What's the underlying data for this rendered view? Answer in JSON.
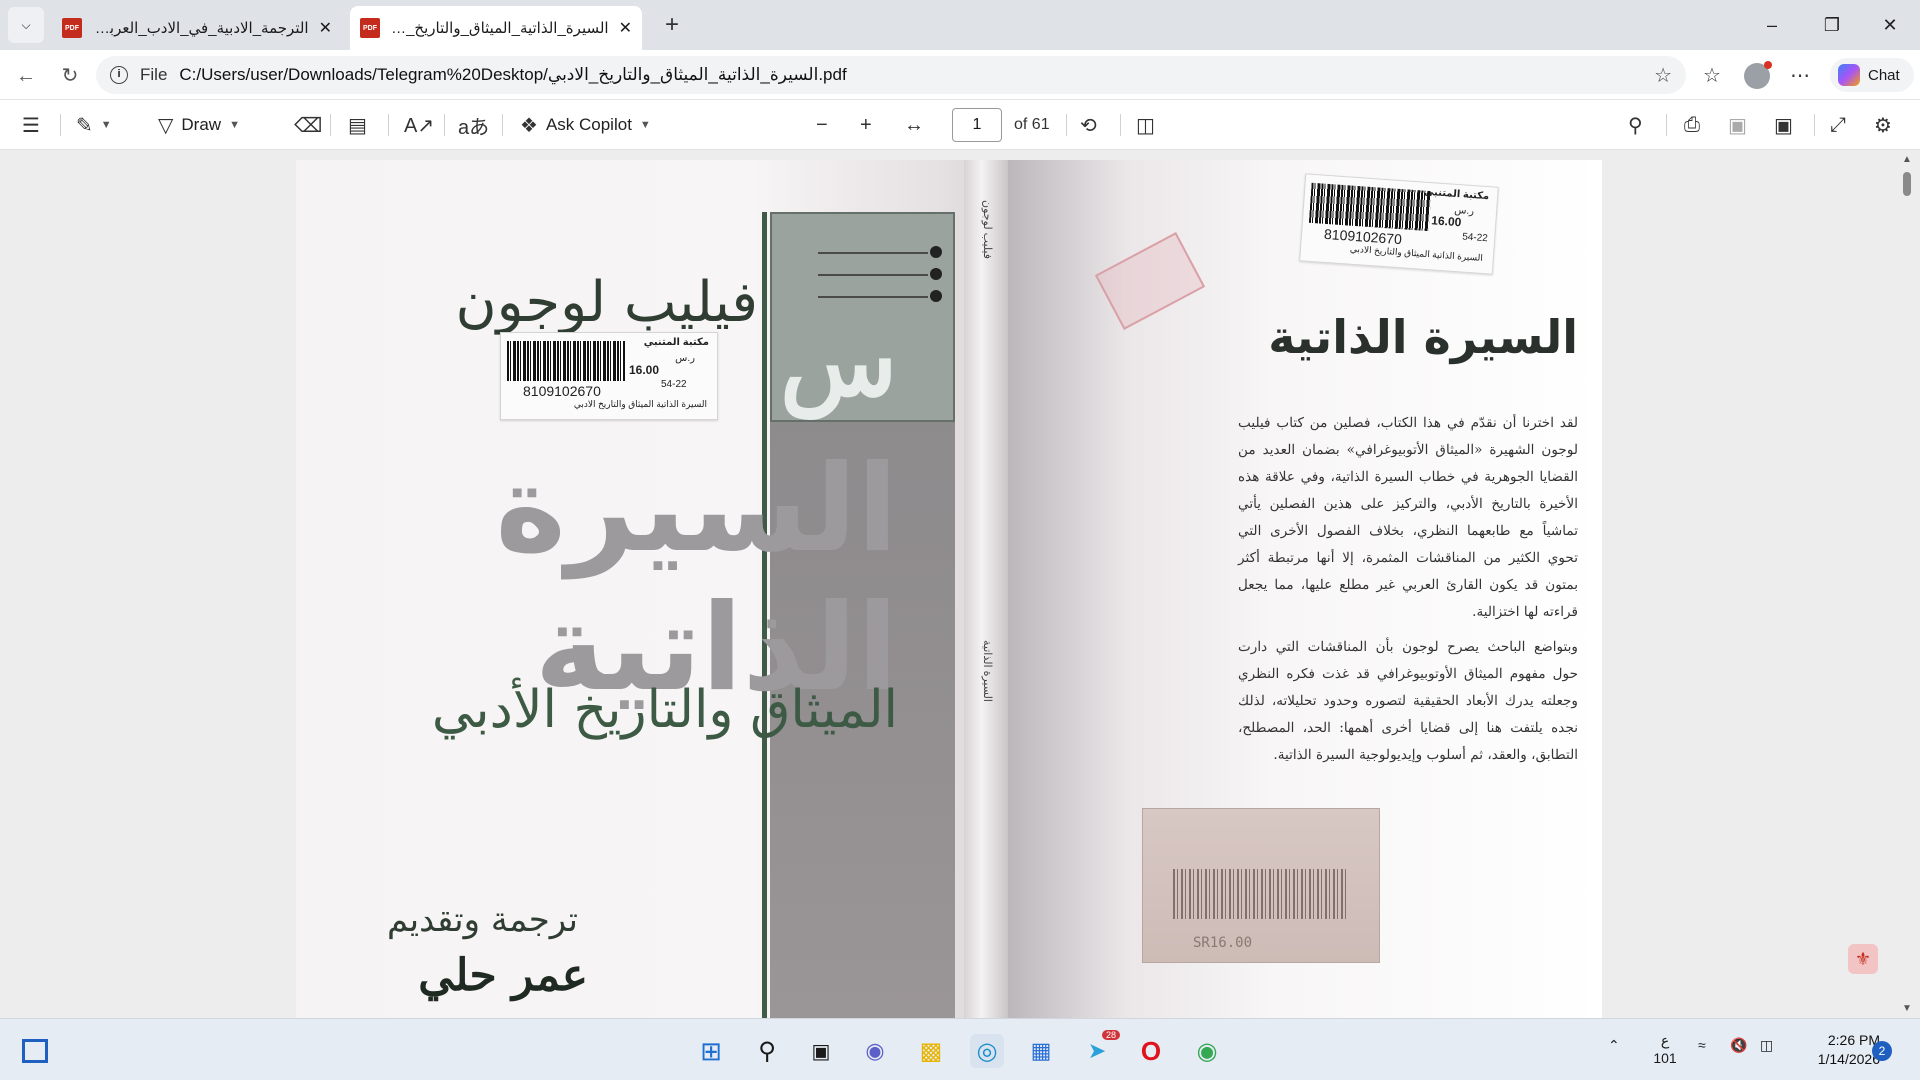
{
  "browser": {
    "tabs": [
      {
        "title": "الترجمة_الادبية_في_الادب_العربي_الحـ",
        "active": false,
        "icon": "pdf-icon"
      },
      {
        "title": "السيرة_الذاتية_الميثاق_والتاريخ_الادبي",
        "active": true,
        "icon": "pdf-icon"
      }
    ],
    "address": {
      "scheme_label": "File",
      "url": "C:/Users/user/Downloads/Telegram%20Desktop/السيرة_الذاتية_الميثاق_والتاريخ_الادبي.pdf"
    },
    "chat_label": "Chat"
  },
  "pdf_toolbar": {
    "draw_label": "Draw",
    "copilot_label": "Ask Copilot",
    "page_current": "1",
    "page_total_label": "of 61"
  },
  "book": {
    "author": "فيليب لوجون",
    "title": "السيرة الذاتية",
    "subtitle": "الميثاق والتاريخ الأدبي",
    "translator_label": "ترجمة وتقديم",
    "translator": "عمر حلي",
    "sticker": {
      "store": "مكتبة المتنبي",
      "currency": "ر.س",
      "price": "16.00",
      "code": "8109102670",
      "ref": "54-22",
      "book_title": "السيرة الذاتية الميثاق والتاريخ الادبي"
    },
    "spine_top": "فيليب لوجون",
    "spine_mid": "السيرة الذاتية",
    "back_title": "السيرة الذاتية",
    "back_paragraphs": [
      "لقد اخترنا أن نقدّم في هذا الكتاب، فصلين من كتاب فيليب لوجون الشهيرة «الميثاق الأتوبيوغرافي» بضمان العديد من القضايا الجوهرية في خطاب السيرة الذاتية، وفي علاقة هذه الأخيرة بالتاريخ الأدبي، والتركيز على هذين الفصلين يأتي تماشياً مع طابعهما النظري، بخلاف الفصول الأخرى التي تحوي الكثير من المناقشات المثمرة، إلا أنها مرتبطة أكثر بمتون قد يكون القارئ العربي غير مطلع عليها، مما يجعل قراءته لها اختزالية.",
      "وبتواضع الباحث يصرح لوجون بأن المناقشات التي دارت حول مفهوم الميثاق الأوتوبيوغرافي قد غذت فكره النظري وجعلته يدرك الأبعاد الحقيقية لتصوره وحدود تحليلاته، لذلك نجده يلتفت هنا إلى قضايا أخرى أهمها: الحد، المصطلح، التطابق، والعقد، ثم أسلوب وإيديولوجية السيرة الذاتية."
    ],
    "bottom_stamp_label": "SR16.00"
  },
  "taskbar": {
    "telegram_badge": "28",
    "lang_top": "ع",
    "lang_bottom": "101",
    "time": "2:26 PM",
    "date": "1/14/2026",
    "notification_count": "2"
  },
  "colors": {
    "accent_tab": "#ffffff",
    "tabbar_bg": "#dfe3e8",
    "cover_green": "#3f5b48",
    "title_gray": "#9c9a9c"
  }
}
